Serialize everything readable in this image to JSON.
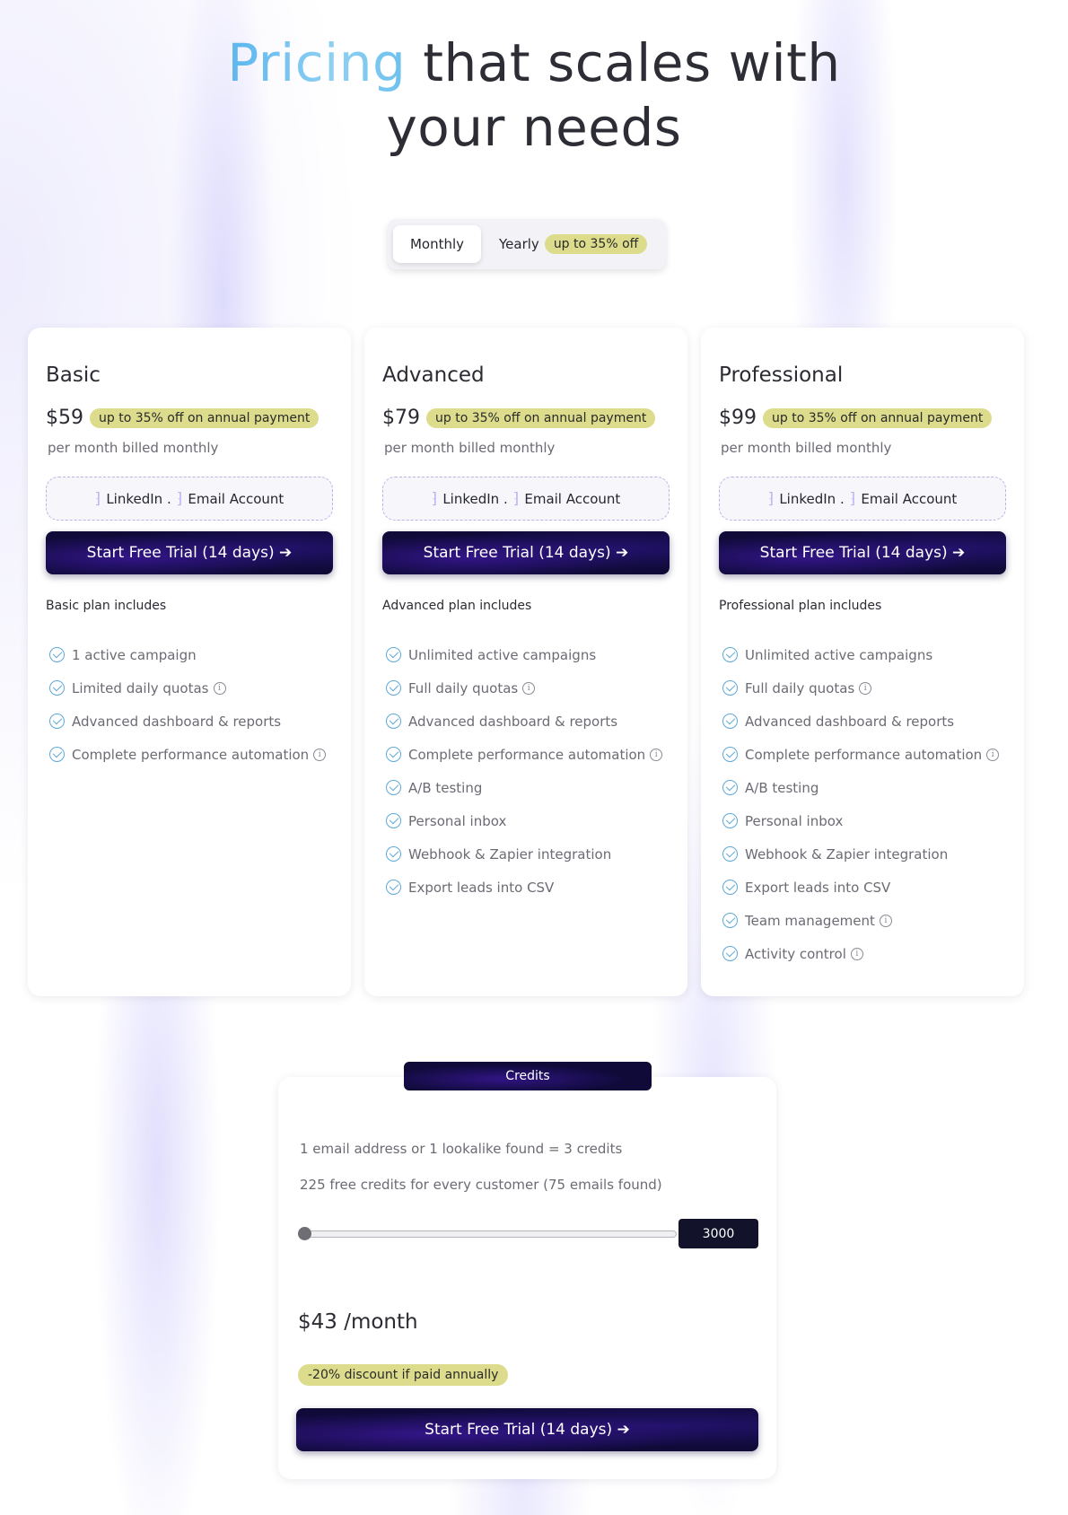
{
  "hero": {
    "accent": "Pricing",
    "title_rest": " that scales with",
    "title_line2": "your needs"
  },
  "toggle": {
    "monthly": "Monthly",
    "yearly": "Yearly",
    "yearly_badge": "up to 35% off"
  },
  "icons": {
    "check": "check-circle-icon",
    "info": "info-icon",
    "arrow": "arrow-right-icon"
  },
  "colors": {
    "cta_dark": "#0f0a38",
    "badge": "#dcdc8c",
    "accent_blue": "#5bb6ee"
  },
  "plans": [
    {
      "name": "Basic",
      "price": "$59",
      "badge": "up to 35% off on annual payment",
      "billing": "per month billed monthly",
      "accounts": {
        "linkedin": "LinkedIn .",
        "email": "Email Account"
      },
      "cta": "Start Free Trial (14 days) ➔",
      "includes": "Basic plan includes",
      "features": [
        {
          "text": "1 active campaign",
          "info": false
        },
        {
          "text": "Limited daily quotas",
          "info": true
        },
        {
          "text": "Advanced dashboard & reports",
          "info": false
        },
        {
          "text": "Complete performance automation",
          "info": true
        }
      ]
    },
    {
      "name": "Advanced",
      "price": "$79",
      "badge": "up to 35% off on annual payment",
      "billing": "per month billed monthly",
      "accounts": {
        "linkedin": "LinkedIn .",
        "email": "Email Account"
      },
      "cta": "Start Free Trial (14 days) ➔",
      "includes": "Advanced plan includes",
      "features": [
        {
          "text": "Unlimited active campaigns",
          "info": false
        },
        {
          "text": "Full daily quotas",
          "info": true
        },
        {
          "text": "Advanced dashboard & reports",
          "info": false
        },
        {
          "text": "Complete performance automation",
          "info": true
        },
        {
          "text": "A/B testing",
          "info": false
        },
        {
          "text": "Personal inbox",
          "info": false
        },
        {
          "text": "Webhook & Zapier integration",
          "info": false
        },
        {
          "text": "Export leads into CSV",
          "info": false
        }
      ]
    },
    {
      "name": "Professional",
      "price": "$99",
      "badge": "up to 35% off on annual payment",
      "billing": "per month billed monthly",
      "accounts": {
        "linkedin": "LinkedIn .",
        "email": "Email Account"
      },
      "cta": "Start Free Trial (14 days) ➔",
      "includes": "Professional plan includes",
      "features": [
        {
          "text": "Unlimited active campaigns",
          "info": false
        },
        {
          "text": "Full daily quotas",
          "info": true
        },
        {
          "text": "Advanced dashboard & reports",
          "info": false
        },
        {
          "text": "Complete performance automation",
          "info": true
        },
        {
          "text": "A/B testing",
          "info": false
        },
        {
          "text": "Personal inbox",
          "info": false
        },
        {
          "text": "Webhook & Zapier integration",
          "info": false
        },
        {
          "text": "Export leads into CSV",
          "info": false
        },
        {
          "text": "Team management",
          "info": true
        },
        {
          "text": "Activity control",
          "info": true
        }
      ]
    }
  ],
  "credits": {
    "tab": "Credits",
    "line1": "1 email address or 1 lookalike found = 3 credits",
    "line2": "225 free credits for every customer (75 emails found)",
    "slider_value": "3000",
    "slider_fraction": 0.0,
    "price": "$43 /month",
    "discount": "-20% discount if paid annually",
    "cta": "Start Free Trial (14 days) ➔"
  }
}
